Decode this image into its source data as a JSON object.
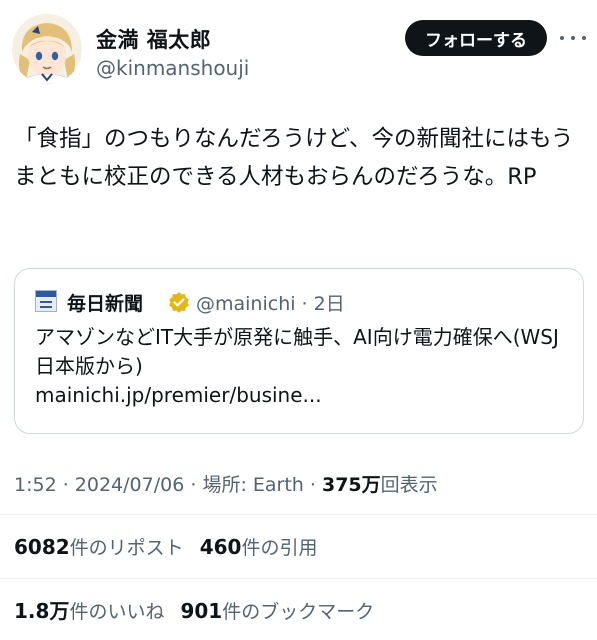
{
  "author": {
    "name": "金満 福太郎",
    "handle": "@kinmanshouji",
    "follow_label": "フォローする"
  },
  "tweet": {
    "text": "「食指」のつもりなんだろうけど、今の新聞社にはもうまともに校正のできる人材もおらんのだろうな。RP"
  },
  "quote": {
    "name": "毎日新聞",
    "handle_time": "@mainichi · 2日",
    "text": "アマゾンなどIT大手が原発に触手、AI向け電力確保へ(WSJ日本版から)",
    "link": "mainichi.jp/premier/busine..."
  },
  "meta": {
    "time_date": "1:52 · 2024/07/06",
    "place": "場所: Earth",
    "views_count": "375万",
    "views_label": "回表示"
  },
  "stats": {
    "reposts_count": "6082",
    "reposts_label": "件のリポスト",
    "quotes_count": "460",
    "quotes_label": "件の引用",
    "likes_count": "1.8万",
    "likes_label": "件のいいね",
    "bookmarks_count": "901",
    "bookmarks_label": "件のブックマーク"
  },
  "colors": {
    "text": "#0f1419",
    "secondary": "#536471",
    "border": "#cfd9de",
    "verified_gold": "#e2b719"
  }
}
